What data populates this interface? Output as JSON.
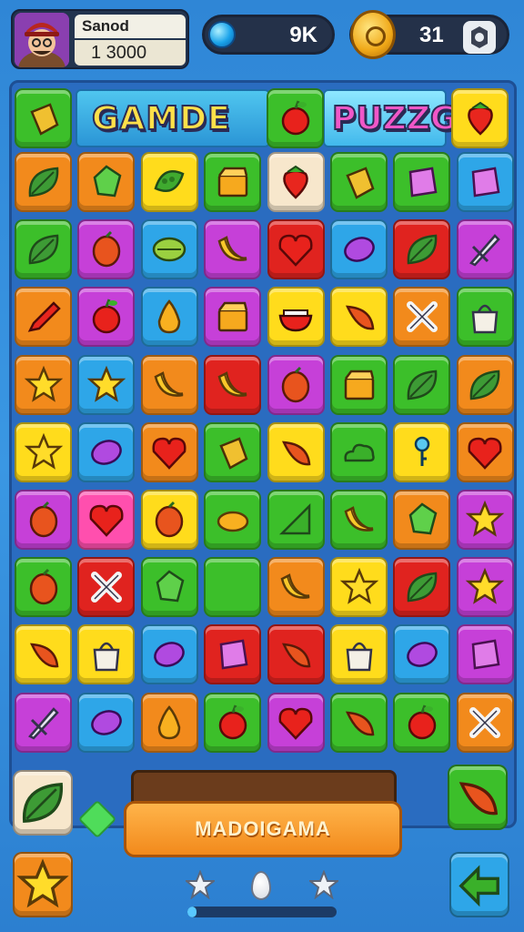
{
  "player": {
    "name": "Sanod",
    "score": "1  3000",
    "avatar_icon": "character-avatar-icon"
  },
  "gems": {
    "value": "9K",
    "icon": "gem-icon"
  },
  "coins": {
    "value": "31",
    "icon": "coin-icon"
  },
  "settings": {
    "icon": "settings-icon"
  },
  "banner": {
    "left_title": "GAMDE",
    "right_title": "PUZZG"
  },
  "colors": {
    "orange": "#f28a1c",
    "green": "#3cbf2a",
    "yellow": "#ffdc1c",
    "blue": "#2ea6e8",
    "purple": "#c640d8",
    "red": "#e0231f",
    "pink": "#ff4fae",
    "cream": "#f7e7cc"
  },
  "board": {
    "rows": [
      [
        "orange:leaf",
        "orange:gem",
        "yellow:pod",
        "green:box",
        "cream:strawberry",
        "green:grape",
        "green:block",
        "blue:block"
      ],
      [
        "green:leaf",
        "purple:mango",
        "blue:melon",
        "purple:banana",
        "red:heart",
        "blue:bean",
        "red:leaf",
        "purple:sword"
      ],
      [
        "orange:pencil",
        "purple:apple",
        "blue:pear",
        "purple:box",
        "yellow:bowl",
        "yellow:chili",
        "orange:cross",
        "green:bag"
      ],
      [
        "orange:star",
        "blue:star",
        "orange:banana",
        "red:banana",
        "purple:mango",
        "green:box",
        "green:leaf",
        "orange:leaf"
      ],
      [
        "yellow:star",
        "blue:bean",
        "orange:heart",
        "green:grape",
        "yellow:chili",
        "green:cloud",
        "yellow:key",
        "orange:heart"
      ],
      [
        "purple:mango",
        "pink:heart",
        "yellow:mango",
        "green:lemon",
        "green:triangle",
        "green:banana",
        "orange:gem",
        "purple:star"
      ],
      [
        "green:mango",
        "red:cross",
        "green:gem",
        "green:blank",
        "orange:banana",
        "yellow:star",
        "red:leaf",
        "purple:star"
      ],
      [
        "yellow:chili",
        "yellow:bag",
        "blue:bean",
        "red:block",
        "red:chili",
        "yellow:bag",
        "blue:bean",
        "purple:block"
      ],
      [
        "purple:sword",
        "blue:bean",
        "orange:pear",
        "green:apple",
        "purple:heart",
        "green:chili",
        "green:apple",
        "orange:cross"
      ]
    ],
    "header_tiles": [
      "green:grape",
      "green:apple",
      "yellow:strawberry"
    ],
    "header_right_tile": "yellow:strawberry"
  },
  "bottom": {
    "button_label": "MADOIGAMA",
    "left_tile": "cream:leaf",
    "right_tile": "green:chili",
    "booster_left": "orange:star",
    "booster_right": "blue:arrow",
    "progress": 0.06,
    "stars": [
      "star-icon",
      "egg-icon",
      "star-icon"
    ]
  }
}
